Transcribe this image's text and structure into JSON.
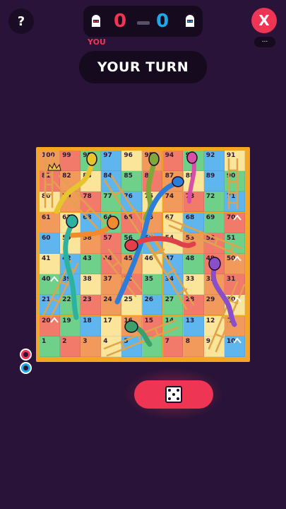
{
  "header": {
    "help_label": "?",
    "close_label": "X",
    "menu_label": "...",
    "you_label": "YOU",
    "turn_text": "YOUR TURN"
  },
  "score": {
    "player_score": "0",
    "opponent_score": "0",
    "player_color": "#ee3553",
    "opponent_color": "#1ea9e8"
  },
  "board": {
    "rows": [
      [
        100,
        99,
        98,
        97,
        96,
        95,
        94,
        93,
        92,
        91
      ],
      [
        81,
        82,
        83,
        84,
        85,
        86,
        87,
        88,
        89,
        90
      ],
      [
        80,
        79,
        78,
        77,
        76,
        75,
        74,
        73,
        72,
        71
      ],
      [
        61,
        62,
        63,
        64,
        65,
        66,
        67,
        68,
        69,
        70
      ],
      [
        60,
        59,
        58,
        57,
        56,
        55,
        54,
        53,
        52,
        51
      ],
      [
        41,
        42,
        43,
        44,
        45,
        46,
        47,
        48,
        49,
        50
      ],
      [
        40,
        39,
        38,
        37,
        36,
        35,
        34,
        33,
        32,
        31
      ],
      [
        21,
        22,
        23,
        24,
        25,
        26,
        27,
        28,
        29,
        30
      ],
      [
        20,
        19,
        18,
        17,
        16,
        15,
        14,
        13,
        12,
        11
      ],
      [
        1,
        2,
        3,
        4,
        5,
        6,
        7,
        8,
        9,
        10
      ]
    ],
    "cell_colors": [
      "#f29a5c",
      "#6fd089",
      "#fbe59a",
      "#f27a6a",
      "#5fb6ef"
    ],
    "frame_color": "#f5a623",
    "snake_colors": [
      "#e8c52f",
      "#7fa83a",
      "#d94fa8",
      "#2c7dd8",
      "#f08a2c",
      "#2bb3a0",
      "#e0404a",
      "#8a4fc8",
      "#3ca06a"
    ],
    "ladder_color": "#e0a24a",
    "crown_icon": "crown-icon",
    "arrow_icon": "chevron-up-icon"
  },
  "players": {
    "player_token": "red-ring-token",
    "opponent_token": "blue-ring-token"
  },
  "controls": {
    "roll_icon": "dice-icon"
  }
}
